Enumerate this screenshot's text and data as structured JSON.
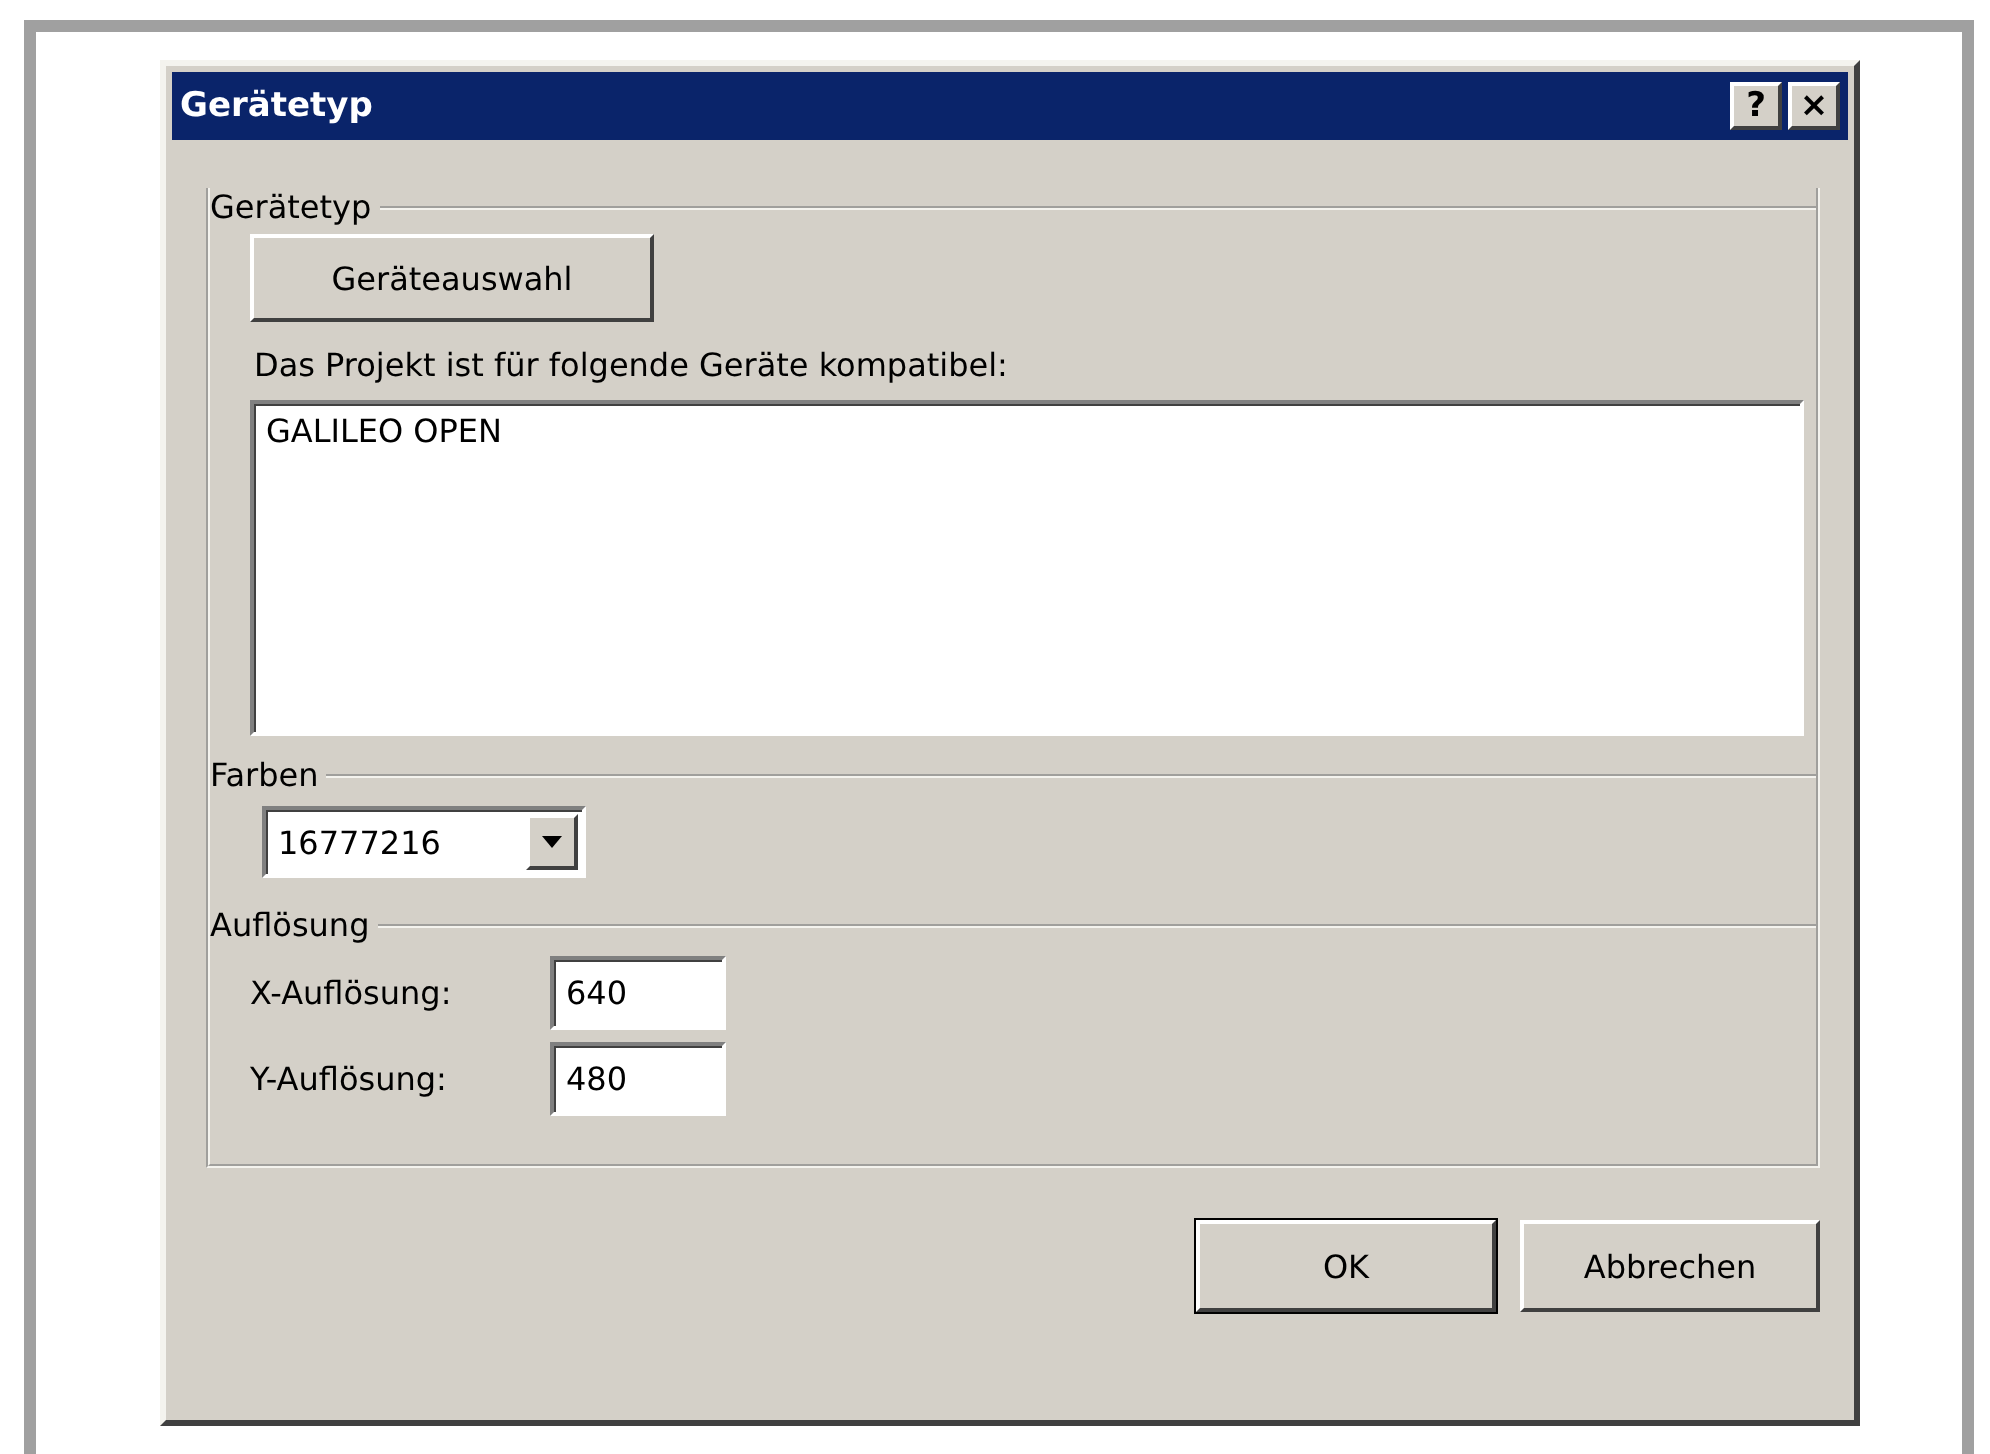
{
  "window": {
    "title": "Gerätetyp",
    "title_buttons": [
      "?",
      "×"
    ]
  },
  "device_group": {
    "label": "Gerätetyp",
    "select_button": "Geräteauswahl",
    "list_label": "Das Projekt ist für folgende Geräte kompatibel:",
    "devices": [
      "GALILEO OPEN"
    ]
  },
  "colors_group": {
    "label": "Farben",
    "value": "16777216"
  },
  "resolution_group": {
    "label": "Auflösung",
    "fields": [
      {
        "label": "X-Auflösung:",
        "value": "640"
      },
      {
        "label": "Y-Auflösung:",
        "value": "480"
      }
    ]
  },
  "buttons": [
    {
      "label": "OK",
      "default": true
    },
    {
      "label": "Abbrechen",
      "default": false
    }
  ]
}
